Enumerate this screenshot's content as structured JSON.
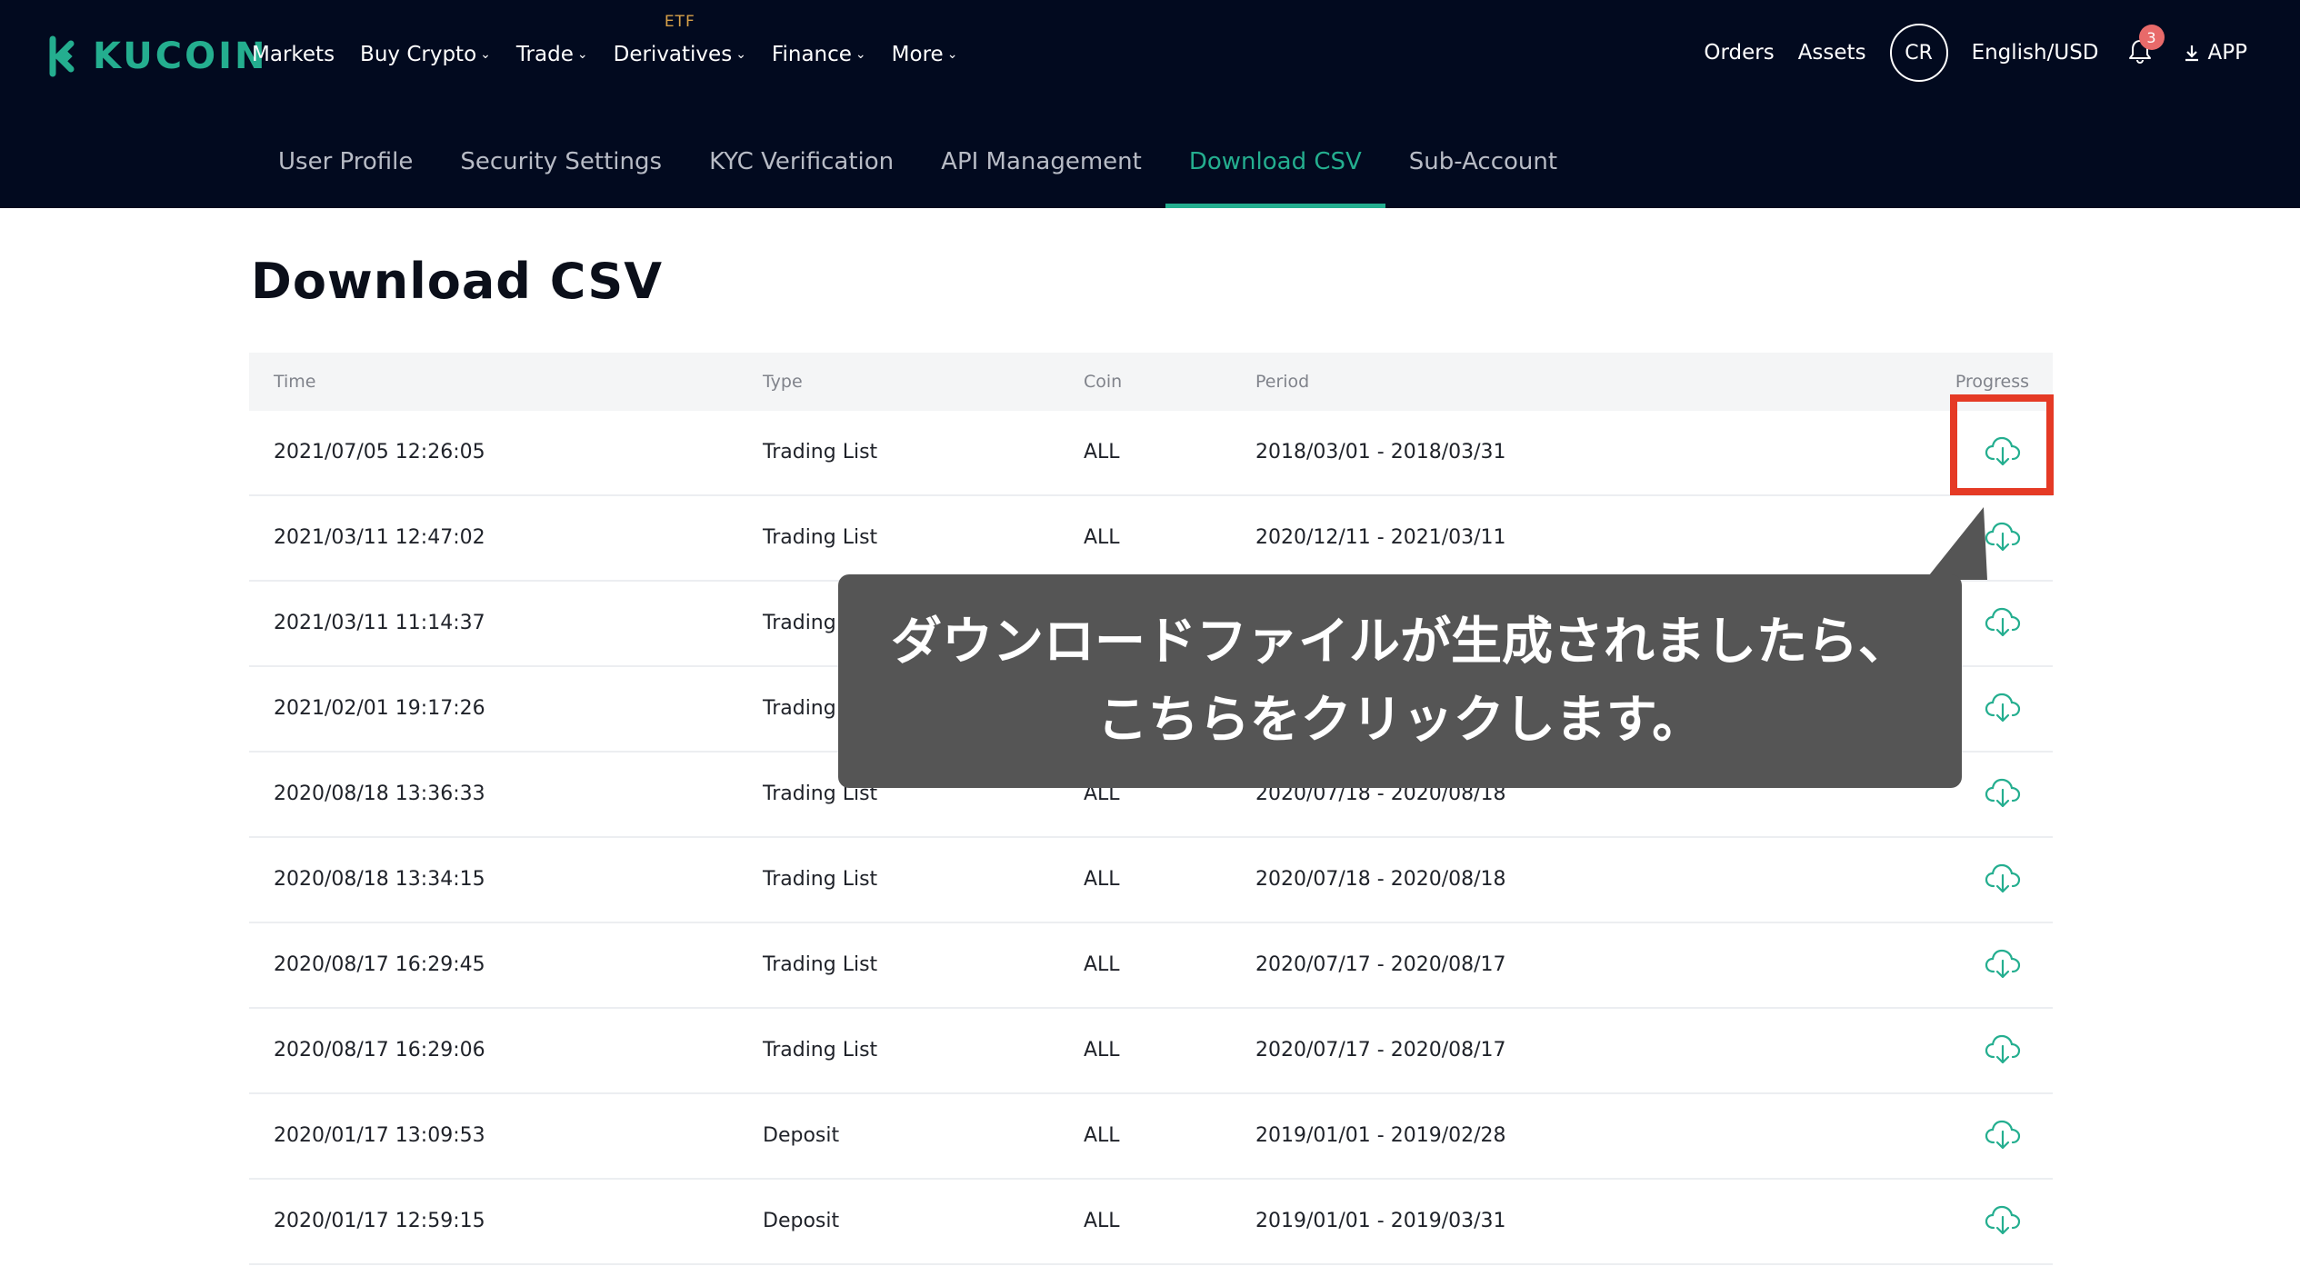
{
  "brand": {
    "name": "KUCOIN",
    "color": "#24ae8f"
  },
  "nav": {
    "items": [
      {
        "label": "Markets",
        "dropdown": false,
        "badge": ""
      },
      {
        "label": "Buy Crypto",
        "dropdown": true,
        "badge": ""
      },
      {
        "label": "Trade",
        "dropdown": true,
        "badge": ""
      },
      {
        "label": "Derivatives",
        "dropdown": true,
        "badge": "ETF"
      },
      {
        "label": "Finance",
        "dropdown": true,
        "badge": ""
      },
      {
        "label": "More",
        "dropdown": true,
        "badge": ""
      }
    ],
    "right": {
      "orders": "Orders",
      "assets": "Assets",
      "avatar": "CR",
      "language": "English/USD",
      "notifications": "3",
      "app": "APP"
    }
  },
  "subnav": {
    "items": [
      {
        "label": "User Profile",
        "active": false
      },
      {
        "label": "Security Settings",
        "active": false
      },
      {
        "label": "KYC Verification",
        "active": false
      },
      {
        "label": "API Management",
        "active": false
      },
      {
        "label": "Download CSV",
        "active": true
      },
      {
        "label": "Sub-Account",
        "active": false
      }
    ]
  },
  "page": {
    "title": "Download CSV"
  },
  "table": {
    "columns": {
      "time": "Time",
      "type": "Type",
      "coin": "Coin",
      "period": "Period",
      "progress": "Progress"
    },
    "rows": [
      {
        "time": "2021/07/05 12:26:05",
        "type": "Trading List",
        "coin": "ALL",
        "period": "2018/03/01 - 2018/03/31"
      },
      {
        "time": "2021/03/11 12:47:02",
        "type": "Trading List",
        "coin": "ALL",
        "period": "2020/12/11 - 2021/03/11"
      },
      {
        "time": "2021/03/11 11:14:37",
        "type": "Trading",
        "coin": "",
        "period": ""
      },
      {
        "time": "2021/02/01 19:17:26",
        "type": "Trading",
        "coin": "",
        "period": ""
      },
      {
        "time": "2020/08/18 13:36:33",
        "type": "Trading List",
        "coin": "ALL",
        "period": "2020/07/18 - 2020/08/18"
      },
      {
        "time": "2020/08/18 13:34:15",
        "type": "Trading List",
        "coin": "ALL",
        "period": "2020/07/18 - 2020/08/18"
      },
      {
        "time": "2020/08/17 16:29:45",
        "type": "Trading List",
        "coin": "ALL",
        "period": "2020/07/17 - 2020/08/17"
      },
      {
        "time": "2020/08/17 16:29:06",
        "type": "Trading List",
        "coin": "ALL",
        "period": "2020/07/17 - 2020/08/17"
      },
      {
        "time": "2020/01/17 13:09:53",
        "type": "Deposit",
        "coin": "ALL",
        "period": "2019/01/01 - 2019/02/28"
      },
      {
        "time": "2020/01/17 12:59:15",
        "type": "Deposit",
        "coin": "ALL",
        "period": "2019/01/01 - 2019/03/31"
      }
    ],
    "row_icon": "cloud-download-icon"
  },
  "annotation": {
    "line1": "ダウンロードファイルが生成されましたら、",
    "line2": "こちらをクリックします。",
    "highlight_color": "#e53a25",
    "callout_color": "#555555"
  }
}
